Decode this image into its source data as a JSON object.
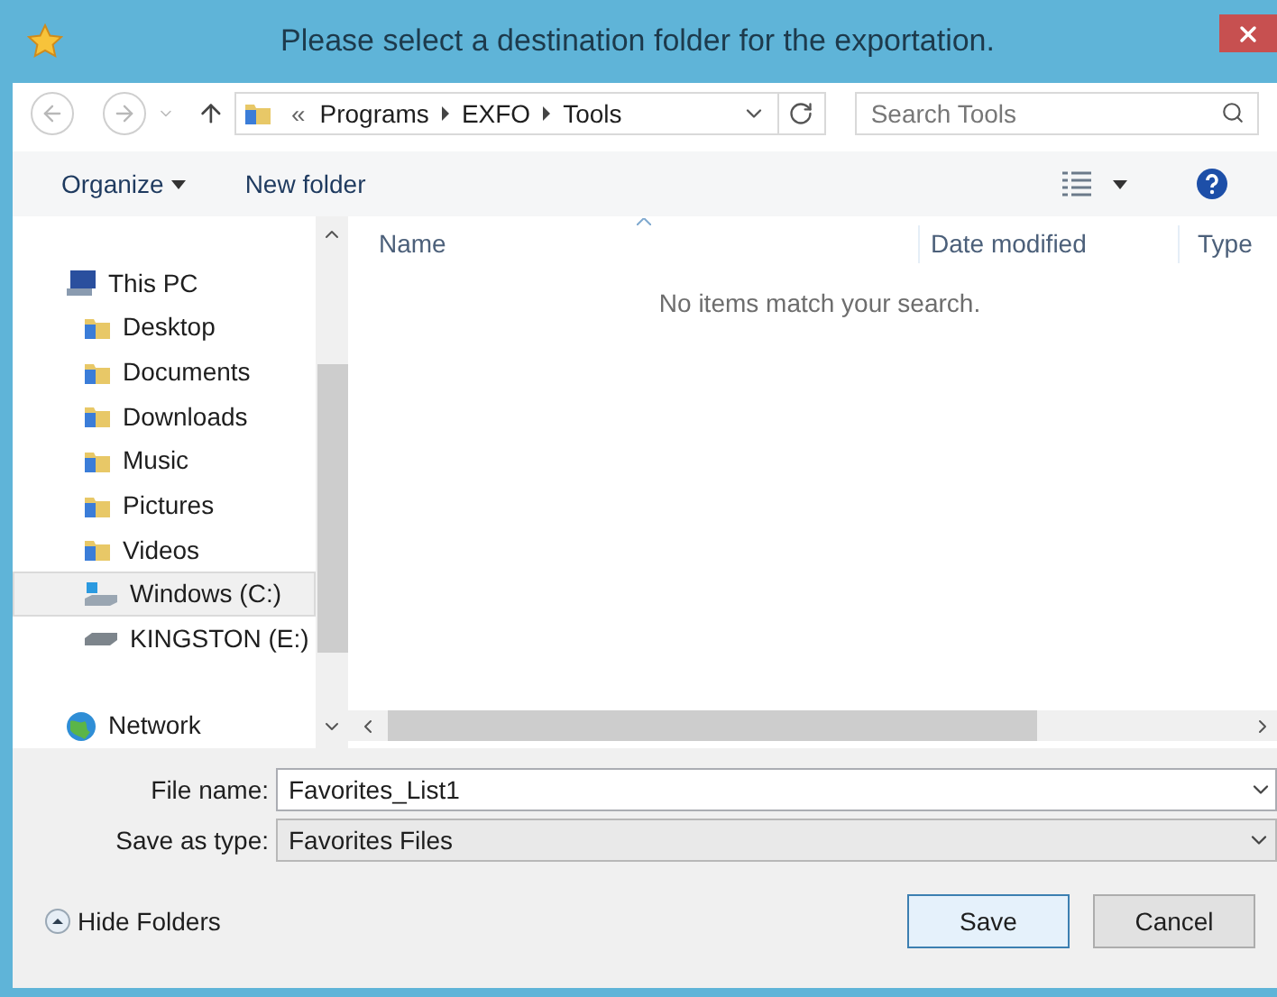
{
  "window": {
    "title": "Please select a destination folder for the exportation."
  },
  "address": {
    "overflow": "«",
    "crumbs": [
      "Programs",
      "EXFO",
      "Tools"
    ]
  },
  "search": {
    "placeholder": "Search Tools"
  },
  "toolbar": {
    "organize": "Organize",
    "new_folder": "New folder"
  },
  "table": {
    "columns": [
      "Name",
      "Date modified",
      "Type"
    ],
    "empty_message": "No items match your search."
  },
  "sidebar": {
    "items": [
      {
        "label": "This PC",
        "kind": "computer",
        "selected": false,
        "children": [
          {
            "label": "Desktop",
            "kind": "folder",
            "selected": false
          },
          {
            "label": "Documents",
            "kind": "folder",
            "selected": false
          },
          {
            "label": "Downloads",
            "kind": "folder",
            "selected": false
          },
          {
            "label": "Music",
            "kind": "folder",
            "selected": false
          },
          {
            "label": "Pictures",
            "kind": "folder",
            "selected": false
          },
          {
            "label": "Videos",
            "kind": "folder",
            "selected": false
          },
          {
            "label": "Windows (C:)",
            "kind": "drive",
            "selected": true
          },
          {
            "label": "KINGSTON (E:)",
            "kind": "usb",
            "selected": false
          }
        ]
      },
      {
        "label": "Network",
        "kind": "network",
        "selected": false
      }
    ]
  },
  "form": {
    "file_name_label": "File name:",
    "file_name": "Favorites_List1",
    "type_label": "Save as type:",
    "type": "Favorites Files"
  },
  "hide_folders": "Hide Folders",
  "buttons": [
    {
      "label": "Save",
      "kind": "primary"
    },
    {
      "label": "Cancel",
      "kind": "normal"
    }
  ]
}
